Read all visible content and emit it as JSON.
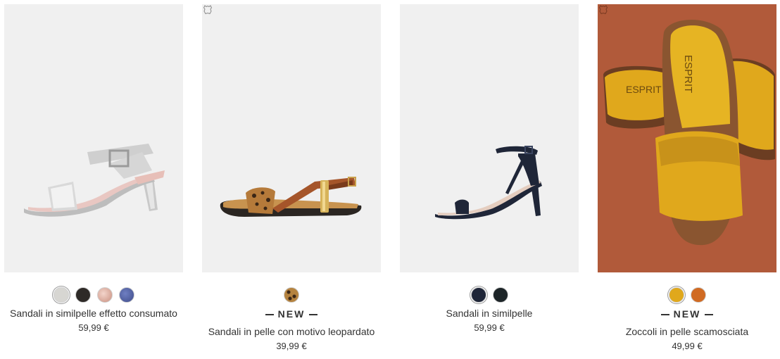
{
  "colors": {
    "image_bg": "#f0f0f0",
    "image_bg_dark": "#b15a3a",
    "text": "#333333"
  },
  "products": [
    {
      "name": "Sandali in similpelle effetto consumato",
      "price": "59,99 €",
      "badge": "",
      "leather_icon": false,
      "swatches": [
        "#d7d6d2",
        "#2e2a27",
        "#d8aa9a",
        "#4b5b9a"
      ],
      "selected_swatch": 0
    },
    {
      "name": "Sandali in pelle con motivo leopardato",
      "price": "39,99 €",
      "badge": "NEW",
      "leather_icon": true,
      "swatches": [
        "#7a4a22"
      ],
      "selected_swatch": -1
    },
    {
      "name": "Sandali in similpelle",
      "price": "59,99 €",
      "badge": "",
      "leather_icon": false,
      "swatches": [
        "#1f2638",
        "#1d2528"
      ],
      "selected_swatch": 0
    },
    {
      "name": "Zoccoli in pelle scamosciata",
      "price": "49,99 €",
      "badge": "NEW",
      "leather_icon": true,
      "swatches": [
        "#e0a81c",
        "#d06a22"
      ],
      "selected_swatch": 0
    }
  ],
  "brand_prints": [
    "ESPRIT",
    "ESPRIT"
  ]
}
